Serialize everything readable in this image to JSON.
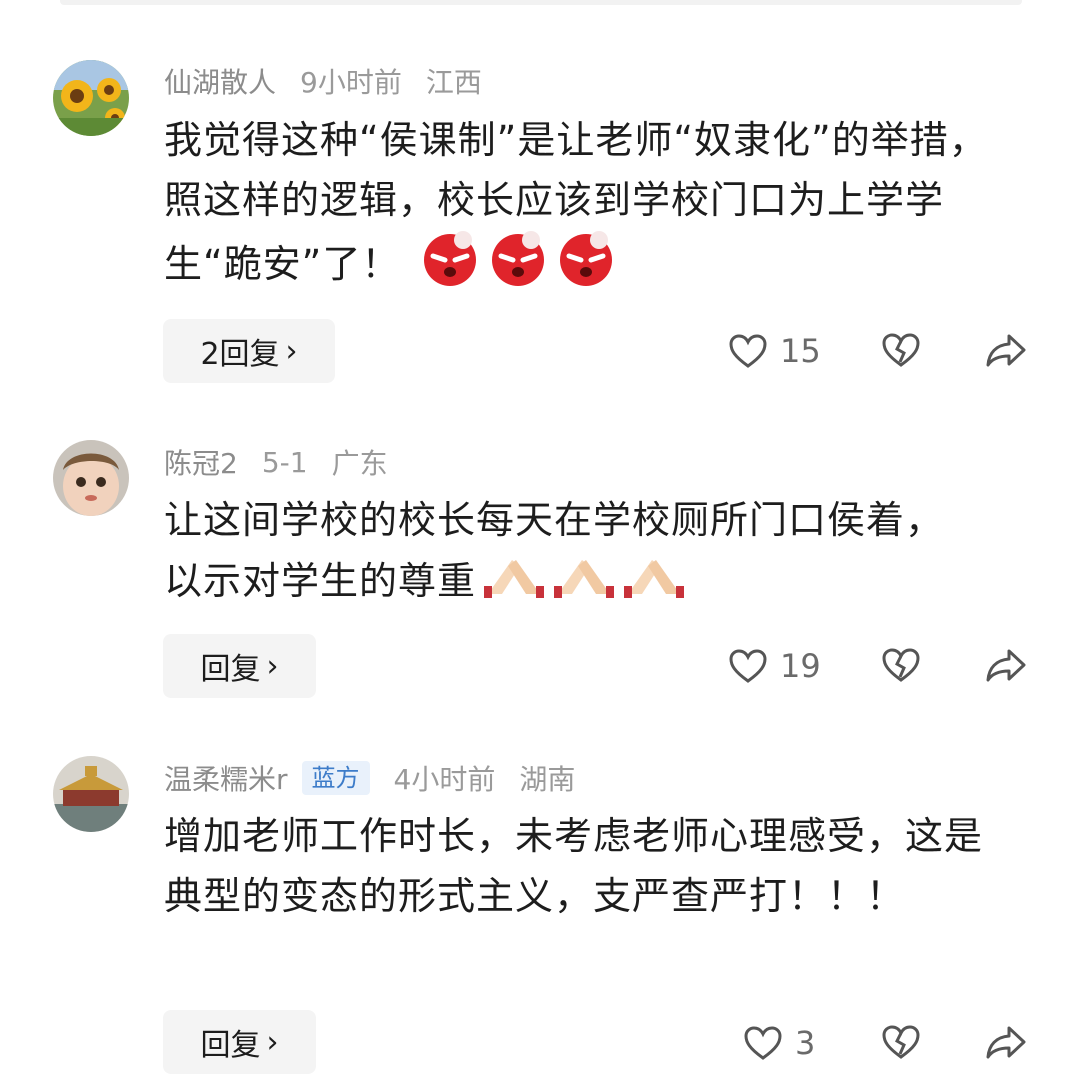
{
  "comments": [
    {
      "name": "仙湖散人",
      "time": "9小时前",
      "location": "江西",
      "tag": "",
      "text": "我觉得这种“侯课制”是让老师“奴隶化”的举措，照这样的逻辑，校长应该到学校门口为上学学生“跪安”了！",
      "emoji": [
        "angry-face-icon",
        "angry-face-icon",
        "angry-face-icon"
      ],
      "reply_label": "2回复",
      "likes": "15"
    },
    {
      "name": "陈冠2",
      "time": "5-1",
      "location": "广东",
      "tag": "",
      "text": "让这间学校的校长每天在学校厕所门口侯着，以示对学生的尊重",
      "emoji": [
        "clap-hands-icon",
        "clap-hands-icon",
        "clap-hands-icon"
      ],
      "reply_label": "回复",
      "likes": "19"
    },
    {
      "name": "温柔糯米r",
      "time": "4小时前",
      "location": "湖南",
      "tag": "蓝方",
      "text": "增加老师工作时长，未考虑老师心理感受，这是典型的变态的形式主义，支严查严打！！！",
      "emoji": [],
      "reply_label": "回复",
      "likes": "3"
    }
  ],
  "icons": {
    "like": "heart-outline-icon",
    "dislike": "broken-heart-icon",
    "share": "share-arrow-icon",
    "chevron": "chevron-right-icon"
  },
  "chevron_glyph": "›",
  "colors": {
    "tag_bg": "#e9f1fb",
    "tag_text": "#3d7cc9",
    "meta": "#9a9a9a"
  }
}
